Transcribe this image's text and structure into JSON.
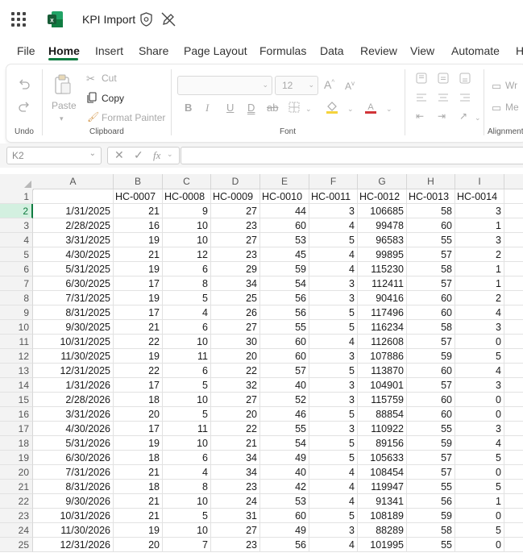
{
  "app": {
    "title": "KPI Import"
  },
  "icons": {
    "waffle": "app-launcher-icon",
    "logo": "excel-logo-icon",
    "sensitivity": "sensitivity-icon",
    "editing": "editing-disabled-icon"
  },
  "colors": {
    "accent": "#107c41",
    "selected_row_bg": "#d3f0e0"
  },
  "menu_tabs": [
    "File",
    "Home",
    "Insert",
    "Share",
    "Page Layout",
    "Formulas",
    "Data",
    "Review",
    "View",
    "Automate",
    "H"
  ],
  "active_tab": "Home",
  "ribbon": {
    "undo_group": "Undo",
    "paste": "Paste",
    "cut": "Cut",
    "copy": "Copy",
    "format_painter": "Format Painter",
    "clipboard_group": "Clipboard",
    "font_size": "12",
    "font_group": "Font",
    "wrap_partial": "Wr",
    "merge_partial": "Me",
    "alignment_group": "Alignment"
  },
  "formula_bar": {
    "name_box": "K2",
    "fx": "fx",
    "formula": ""
  },
  "sheet": {
    "columns": [
      "A",
      "B",
      "C",
      "D",
      "E",
      "F",
      "G",
      "H",
      "I"
    ],
    "headers": [
      "",
      "HC-0007",
      "HC-0008",
      "HC-0009",
      "HC-0010",
      "HC-0011",
      "HC-0012",
      "HC-0013",
      "HC-0014"
    ],
    "selected_row": 2,
    "rows": [
      [
        "1/31/2025",
        "21",
        "9",
        "27",
        "44",
        "3",
        "106685",
        "58",
        "3"
      ],
      [
        "2/28/2025",
        "16",
        "10",
        "23",
        "60",
        "4",
        "99478",
        "60",
        "1"
      ],
      [
        "3/31/2025",
        "19",
        "10",
        "27",
        "53",
        "5",
        "96583",
        "55",
        "3"
      ],
      [
        "4/30/2025",
        "21",
        "12",
        "23",
        "45",
        "4",
        "99895",
        "57",
        "2"
      ],
      [
        "5/31/2025",
        "19",
        "6",
        "29",
        "59",
        "4",
        "115230",
        "58",
        "1"
      ],
      [
        "6/30/2025",
        "17",
        "8",
        "34",
        "54",
        "3",
        "112411",
        "57",
        "1"
      ],
      [
        "7/31/2025",
        "19",
        "5",
        "25",
        "56",
        "3",
        "90416",
        "60",
        "2"
      ],
      [
        "8/31/2025",
        "17",
        "4",
        "26",
        "56",
        "5",
        "117496",
        "60",
        "4"
      ],
      [
        "9/30/2025",
        "21",
        "6",
        "27",
        "55",
        "5",
        "116234",
        "58",
        "3"
      ],
      [
        "10/31/2025",
        "22",
        "10",
        "30",
        "60",
        "4",
        "112608",
        "57",
        "0"
      ],
      [
        "11/30/2025",
        "19",
        "11",
        "20",
        "60",
        "3",
        "107886",
        "59",
        "5"
      ],
      [
        "12/31/2025",
        "22",
        "6",
        "22",
        "57",
        "5",
        "113870",
        "60",
        "4"
      ],
      [
        "1/31/2026",
        "17",
        "5",
        "32",
        "40",
        "3",
        "104901",
        "57",
        "3"
      ],
      [
        "2/28/2026",
        "18",
        "10",
        "27",
        "52",
        "3",
        "115759",
        "60",
        "0"
      ],
      [
        "3/31/2026",
        "20",
        "5",
        "20",
        "46",
        "5",
        "88854",
        "60",
        "0"
      ],
      [
        "4/30/2026",
        "17",
        "11",
        "22",
        "55",
        "3",
        "110922",
        "55",
        "3"
      ],
      [
        "5/31/2026",
        "19",
        "10",
        "21",
        "54",
        "5",
        "89156",
        "59",
        "4"
      ],
      [
        "6/30/2026",
        "18",
        "6",
        "34",
        "49",
        "5",
        "105633",
        "57",
        "5"
      ],
      [
        "7/31/2026",
        "21",
        "4",
        "34",
        "40",
        "4",
        "108454",
        "57",
        "0"
      ],
      [
        "8/31/2026",
        "18",
        "8",
        "23",
        "42",
        "4",
        "119947",
        "55",
        "5"
      ],
      [
        "9/30/2026",
        "21",
        "10",
        "24",
        "53",
        "4",
        "91341",
        "56",
        "1"
      ],
      [
        "10/31/2026",
        "21",
        "5",
        "31",
        "60",
        "5",
        "108189",
        "59",
        "0"
      ],
      [
        "11/30/2026",
        "19",
        "10",
        "27",
        "49",
        "3",
        "88289",
        "58",
        "5"
      ],
      [
        "12/31/2026",
        "20",
        "7",
        "23",
        "56",
        "4",
        "101995",
        "55",
        "0"
      ]
    ]
  }
}
